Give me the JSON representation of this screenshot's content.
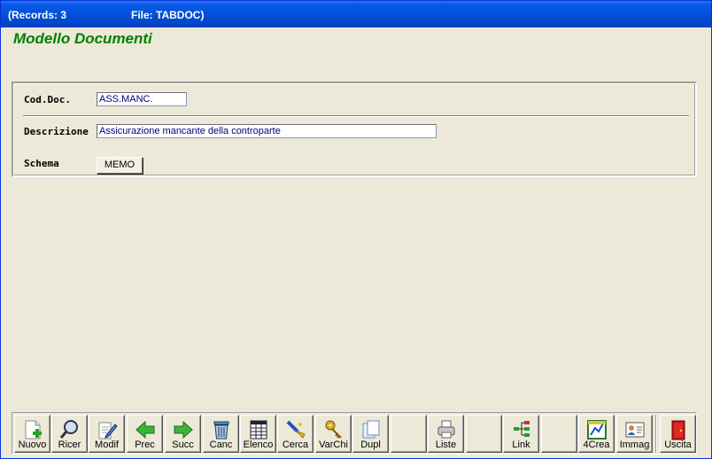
{
  "titlebar": {
    "records": "(Records: 3",
    "file": "File: TABDOC)"
  },
  "page_title": "Modello Documenti",
  "form": {
    "cod_doc_label": "Cod.Doc.",
    "cod_doc_value": "ASS.MANC.",
    "descrizione_label": "Descrizione",
    "descrizione_value": "Assicurazione mancante della controparte",
    "schema_label": "Schema",
    "memo_button": "MEMO"
  },
  "toolbar": {
    "nuovo": "Nuovo",
    "ricer": "Ricer",
    "modif": "Modif",
    "prec": "Prec",
    "succ": "Succ",
    "canc": "Canc",
    "elenco": "Elenco",
    "cerca": "Cerca",
    "varchi": "VarChi",
    "dupl": "Dupl",
    "liste": "Liste",
    "link": "Link",
    "crea4": "4Crea",
    "immag": "Immag",
    "uscita": "Uscita"
  },
  "icons": {
    "nuovo": "new-document-icon",
    "ricer": "search-icon",
    "modif": "edit-icon",
    "prec": "arrow-left-icon",
    "succ": "arrow-right-icon",
    "canc": "trash-icon",
    "elenco": "list-icon",
    "cerca": "find-icon",
    "varchi": "keys-icon",
    "dupl": "duplicate-icon",
    "liste": "printer-icon",
    "link": "hierarchy-icon",
    "crea4": "chart-icon",
    "immag": "image-card-icon",
    "uscita": "exit-door-icon"
  },
  "colors": {
    "title_bar": "#0350d8",
    "page_title": "#008000",
    "field_text": "#000080",
    "window_bg": "#ece9d8"
  }
}
